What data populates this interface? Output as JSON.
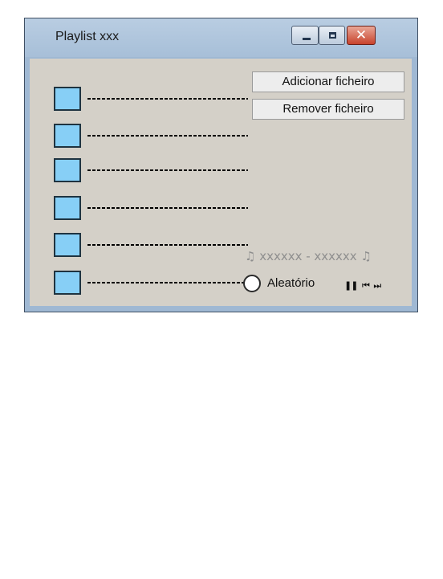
{
  "window": {
    "title": "Playlist xxx",
    "controls": {
      "minimize_icon": "minimize-icon",
      "maximize_icon": "maximize-icon",
      "close_icon": "close-icon",
      "close_glyph": "✕"
    }
  },
  "playlist": {
    "tracks": [
      {
        "label": "------------------------"
      },
      {
        "label": "------------------------"
      },
      {
        "label": "------------------------"
      },
      {
        "label": "------------------------"
      },
      {
        "label": "------------------------"
      },
      {
        "label": "------------------------"
      }
    ]
  },
  "actions": {
    "add_label": "Adicionar ficheiro",
    "remove_label": "Remover ficheiro"
  },
  "player": {
    "now_playing": "♫ xxxxxx - xxxxxx ♫",
    "shuffle_label": "Aleatório",
    "controls": {
      "pause": "❚❚",
      "previous": "⏮",
      "next": "⏭"
    }
  },
  "colors": {
    "window_frame": "#9fb8d3",
    "client_background": "#d4d0c8",
    "track_thumb": "#87cff6",
    "close_button": "#c8432c"
  }
}
